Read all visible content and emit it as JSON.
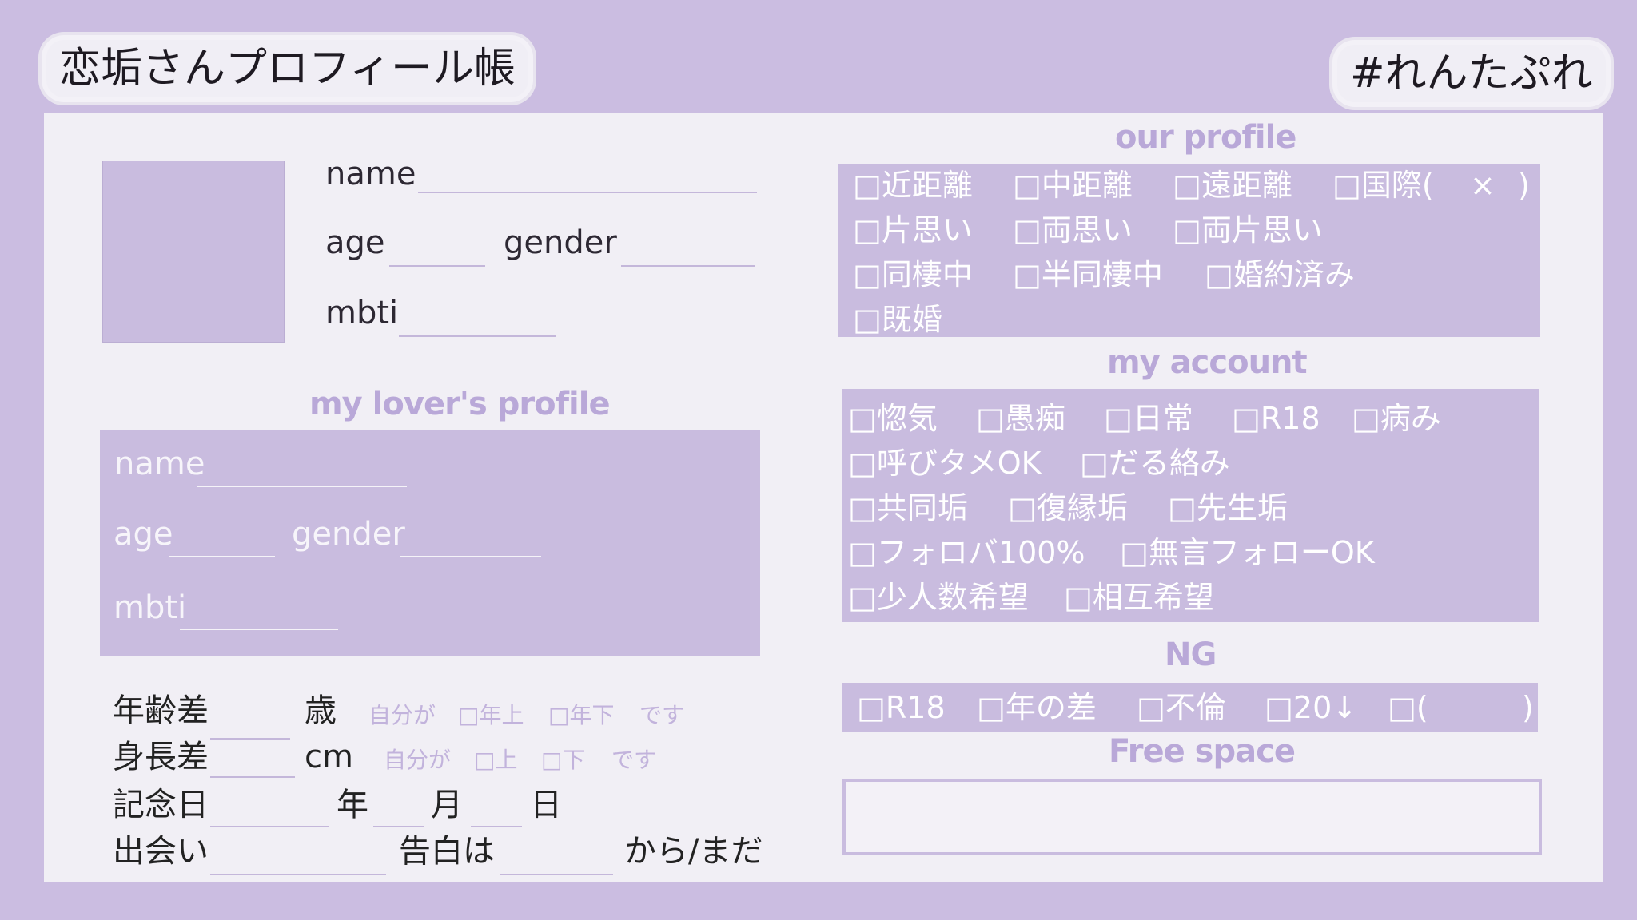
{
  "header": {
    "title": "恋垢さんプロフィール帳",
    "hashtag": "#れんたぷれ"
  },
  "my_profile": {
    "name_label": "name",
    "age_label": "age",
    "gender_label": "gender",
    "mbti_label": "mbti"
  },
  "lover_profile": {
    "title": "my lover's profile",
    "name_label": "name",
    "age_label": "age",
    "gender_label": "gender",
    "mbti_label": "mbti"
  },
  "relations": {
    "age_gap_label": "年齢差",
    "age_unit": "歳",
    "age_note_1": "自分が",
    "age_opt_1": "□年上",
    "age_opt_2": "□年下",
    "age_note_2": "です",
    "height_gap_label": "身長差",
    "height_unit": "cm",
    "height_note_1": "自分が",
    "height_opt_1": "□上",
    "height_opt_2": "□下",
    "height_note_2": "です",
    "anniv_label": "記念日",
    "year": "年",
    "month": "月",
    "day": "日",
    "meet_label": "出会い",
    "confess_label": "告白は",
    "confess_suffix": "から/まだ"
  },
  "our_profile": {
    "title": "our profile",
    "rows": [
      [
        "□近距離",
        "□中距離",
        "□遠距離",
        "□国際(",
        "×",
        ")"
      ],
      [
        "□片思い",
        "□両思い",
        "□両片思い"
      ],
      [
        "□同棲中",
        "□半同棲中",
        "□婚約済み"
      ],
      [
        "□既婚"
      ]
    ]
  },
  "my_account": {
    "title": "my account",
    "rows": [
      [
        "□惚気",
        "□愚痴",
        "□日常",
        "□R18",
        "□病み"
      ],
      [
        "□呼びタメOK",
        "□だる絡み"
      ],
      [
        "□共同垢",
        "□復縁垢",
        "□先生垢"
      ],
      [
        "□フォロバ100%",
        "□無言フォローOK"
      ],
      [
        "□少人数希望",
        "□相互希望"
      ]
    ]
  },
  "ng": {
    "title": "NG",
    "items": [
      "□R18",
      "□年の差",
      "□不倫",
      "□20↓",
      "□(",
      ")"
    ]
  },
  "free_space": {
    "title": "Free space"
  }
}
